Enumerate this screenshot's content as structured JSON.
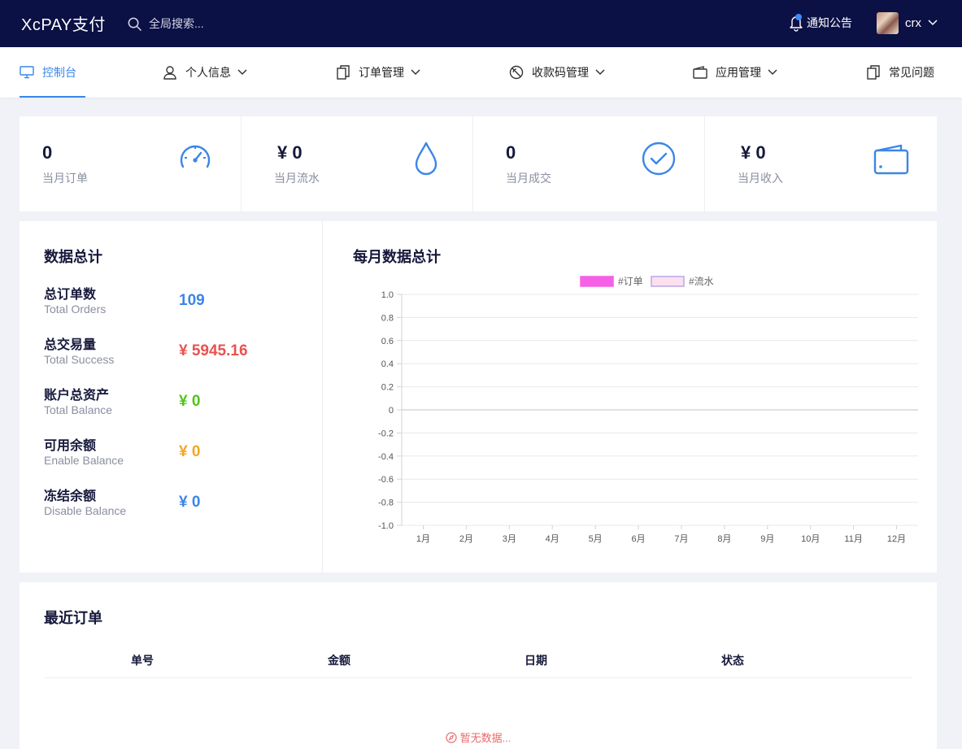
{
  "topbar": {
    "logo": "XcPAY支付",
    "search_placeholder": "全局搜索...",
    "notice_label": "通知公告",
    "username": "crx"
  },
  "nav": {
    "items": [
      {
        "label": "控制台",
        "icon": "monitor-icon",
        "active": true
      },
      {
        "label": "个人信息",
        "icon": "user-icon",
        "dropdown": true
      },
      {
        "label": "订单管理",
        "icon": "documents-icon",
        "dropdown": true
      },
      {
        "label": "收款码管理",
        "icon": "qrcode-icon",
        "dropdown": true
      },
      {
        "label": "应用管理",
        "icon": "wallet-icon",
        "dropdown": true
      },
      {
        "label": "常见问题",
        "icon": "documents-icon"
      }
    ]
  },
  "stats": [
    {
      "value": "0",
      "label": "当月订单",
      "icon": "speedometer-icon"
    },
    {
      "value": "¥ 0",
      "label": "当月流水",
      "icon": "drop-icon"
    },
    {
      "value": "0",
      "label": "当月成交",
      "icon": "check-circle-icon"
    },
    {
      "value": "¥ 0",
      "label": "当月收入",
      "icon": "wallet-icon"
    }
  ],
  "summary": {
    "title": "数据总计",
    "rows": [
      {
        "cn": "总订单数",
        "en": "Total Orders",
        "value": "109",
        "color": "#3a86e8"
      },
      {
        "cn": "总交易量",
        "en": "Total Success",
        "value": "¥ 5945.16",
        "color": "#e8534f"
      },
      {
        "cn": "账户总资产",
        "en": "Total Balance",
        "value": "¥ 0",
        "color": "#52c41a"
      },
      {
        "cn": "可用余额",
        "en": "Enable Balance",
        "value": "¥ 0",
        "color": "#f5a623"
      },
      {
        "cn": "冻结余额",
        "en": "Disable Balance",
        "value": "¥ 0",
        "color": "#3a86e8"
      }
    ]
  },
  "chart_data": {
    "type": "line",
    "title": "每月数据总计",
    "categories": [
      "1月",
      "2月",
      "3月",
      "4月",
      "5月",
      "6月",
      "7月",
      "8月",
      "9月",
      "10月",
      "11月",
      "12月"
    ],
    "series": [
      {
        "name": "#订单",
        "values": [],
        "color": "#f560e6"
      },
      {
        "name": "#流水",
        "values": [],
        "color": "#fde0f0"
      }
    ],
    "yticks": [
      "1.0",
      "0.8",
      "0.6",
      "0.4",
      "0.2",
      "0",
      "-0.2",
      "-0.4",
      "-0.6",
      "-0.8",
      "-1.0"
    ],
    "ylim": [
      -1.0,
      1.0
    ],
    "grid": true,
    "legend": "top-center"
  },
  "orders": {
    "title": "最近订单",
    "columns": [
      "单号",
      "金额",
      "日期",
      "状态"
    ],
    "empty_text": "暂无数据..."
  }
}
